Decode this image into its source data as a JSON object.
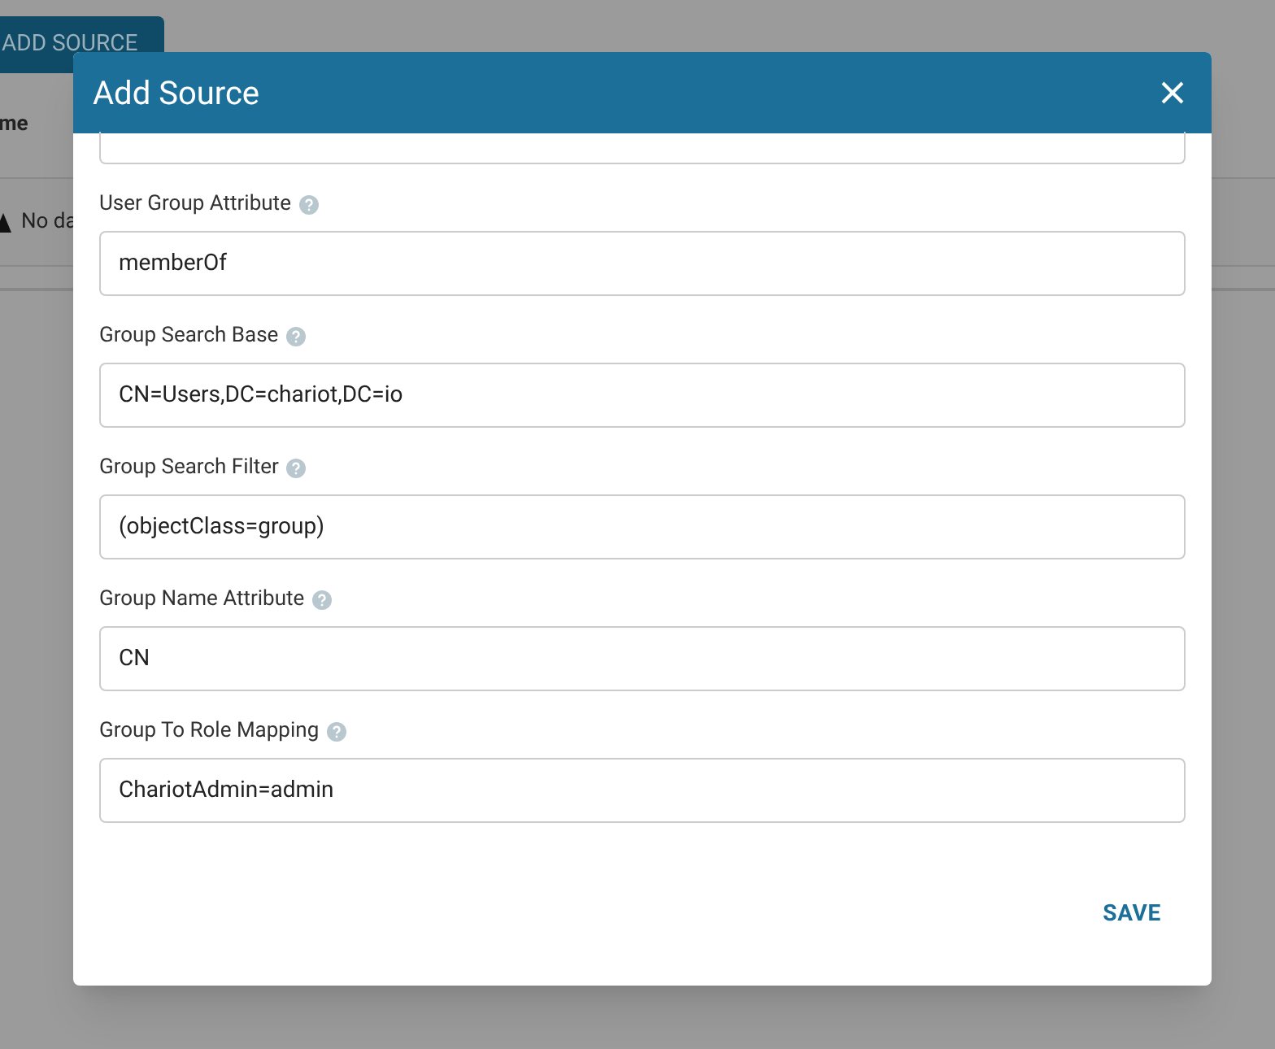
{
  "page": {
    "add_button": "ADD SOURCE",
    "column_1": "me",
    "empty_message": "No da"
  },
  "dialog": {
    "title": "Add Source",
    "fields": [
      {
        "label": "User Group Attribute",
        "value": "memberOf"
      },
      {
        "label": "Group Search Base",
        "value": "CN=Users,DC=chariot,DC=io"
      },
      {
        "label": "Group Search Filter",
        "value": "(objectClass=group)"
      },
      {
        "label": "Group Name Attribute",
        "value": "CN"
      },
      {
        "label": "Group To Role Mapping",
        "value": "ChariotAdmin=admin"
      }
    ],
    "save": "SAVE"
  }
}
